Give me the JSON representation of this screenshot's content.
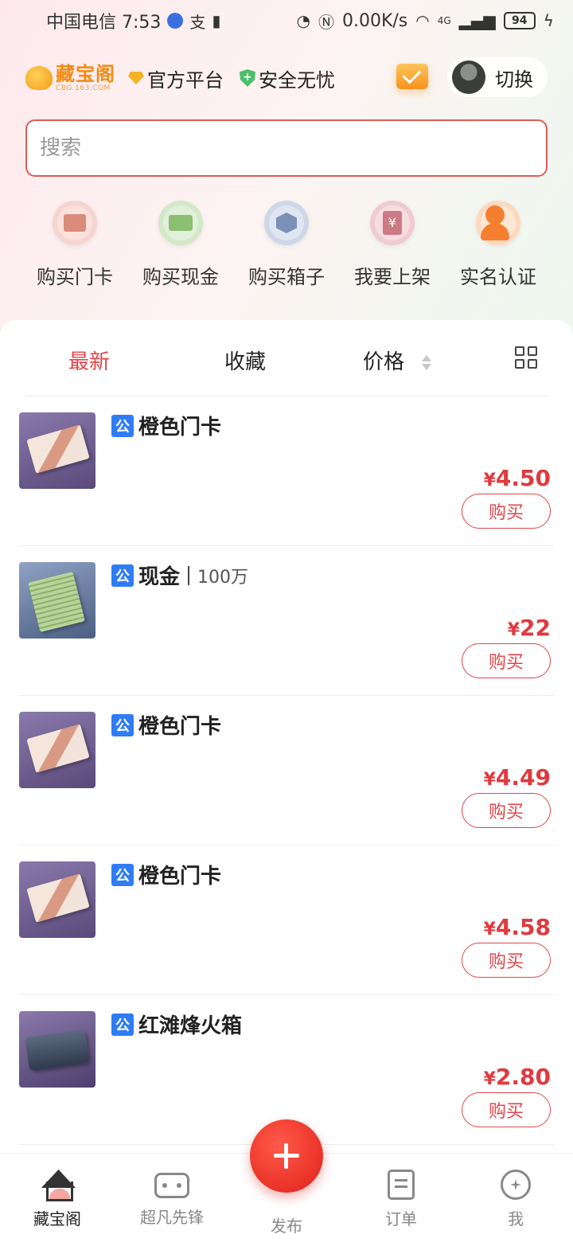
{
  "status_bar": {
    "carrier_time": "中国电信 7:53",
    "network_speed": "0.00K/s",
    "network_type": "4G",
    "battery": "94"
  },
  "header": {
    "logo_name": "藏宝阁",
    "logo_domain": "CBG.163.COM",
    "badge_official": "官方平台",
    "badge_safe": "安全无忧",
    "switch_label": "切换"
  },
  "search": {
    "placeholder": "搜索"
  },
  "quick_entries": [
    {
      "label": "购买门卡",
      "icon": "door-card-icon"
    },
    {
      "label": "购买现金",
      "icon": "cash-icon"
    },
    {
      "label": "购买箱子",
      "icon": "box-icon"
    },
    {
      "label": "我要上架",
      "icon": "list-item-icon"
    },
    {
      "label": "实名认证",
      "icon": "verify-user-icon"
    }
  ],
  "sort_tabs": {
    "latest": "最新",
    "favorite": "收藏",
    "price": "价格"
  },
  "items": [
    {
      "tag": "公",
      "name": "橙色门卡",
      "sub": "",
      "price": "4.50",
      "buy": "购买",
      "thumb": "card"
    },
    {
      "tag": "公",
      "name": "现金",
      "sub": "100万",
      "price": "22",
      "buy": "购买",
      "thumb": "cash"
    },
    {
      "tag": "公",
      "name": "橙色门卡",
      "sub": "",
      "price": "4.49",
      "buy": "购买",
      "thumb": "card"
    },
    {
      "tag": "公",
      "name": "橙色门卡",
      "sub": "",
      "price": "4.58",
      "buy": "购买",
      "thumb": "card"
    },
    {
      "tag": "公",
      "name": "红滩烽火箱",
      "sub": "",
      "price": "2.80",
      "buy": "购买",
      "thumb": "box"
    }
  ],
  "currency_symbol": "¥",
  "tabbar": {
    "home": "藏宝阁",
    "pioneer": "超凡先锋",
    "publish": "发布",
    "orders": "订单",
    "me": "我"
  },
  "colors": {
    "accent": "#e0454a",
    "price": "#e0393e",
    "tag": "#2f7cf6"
  }
}
